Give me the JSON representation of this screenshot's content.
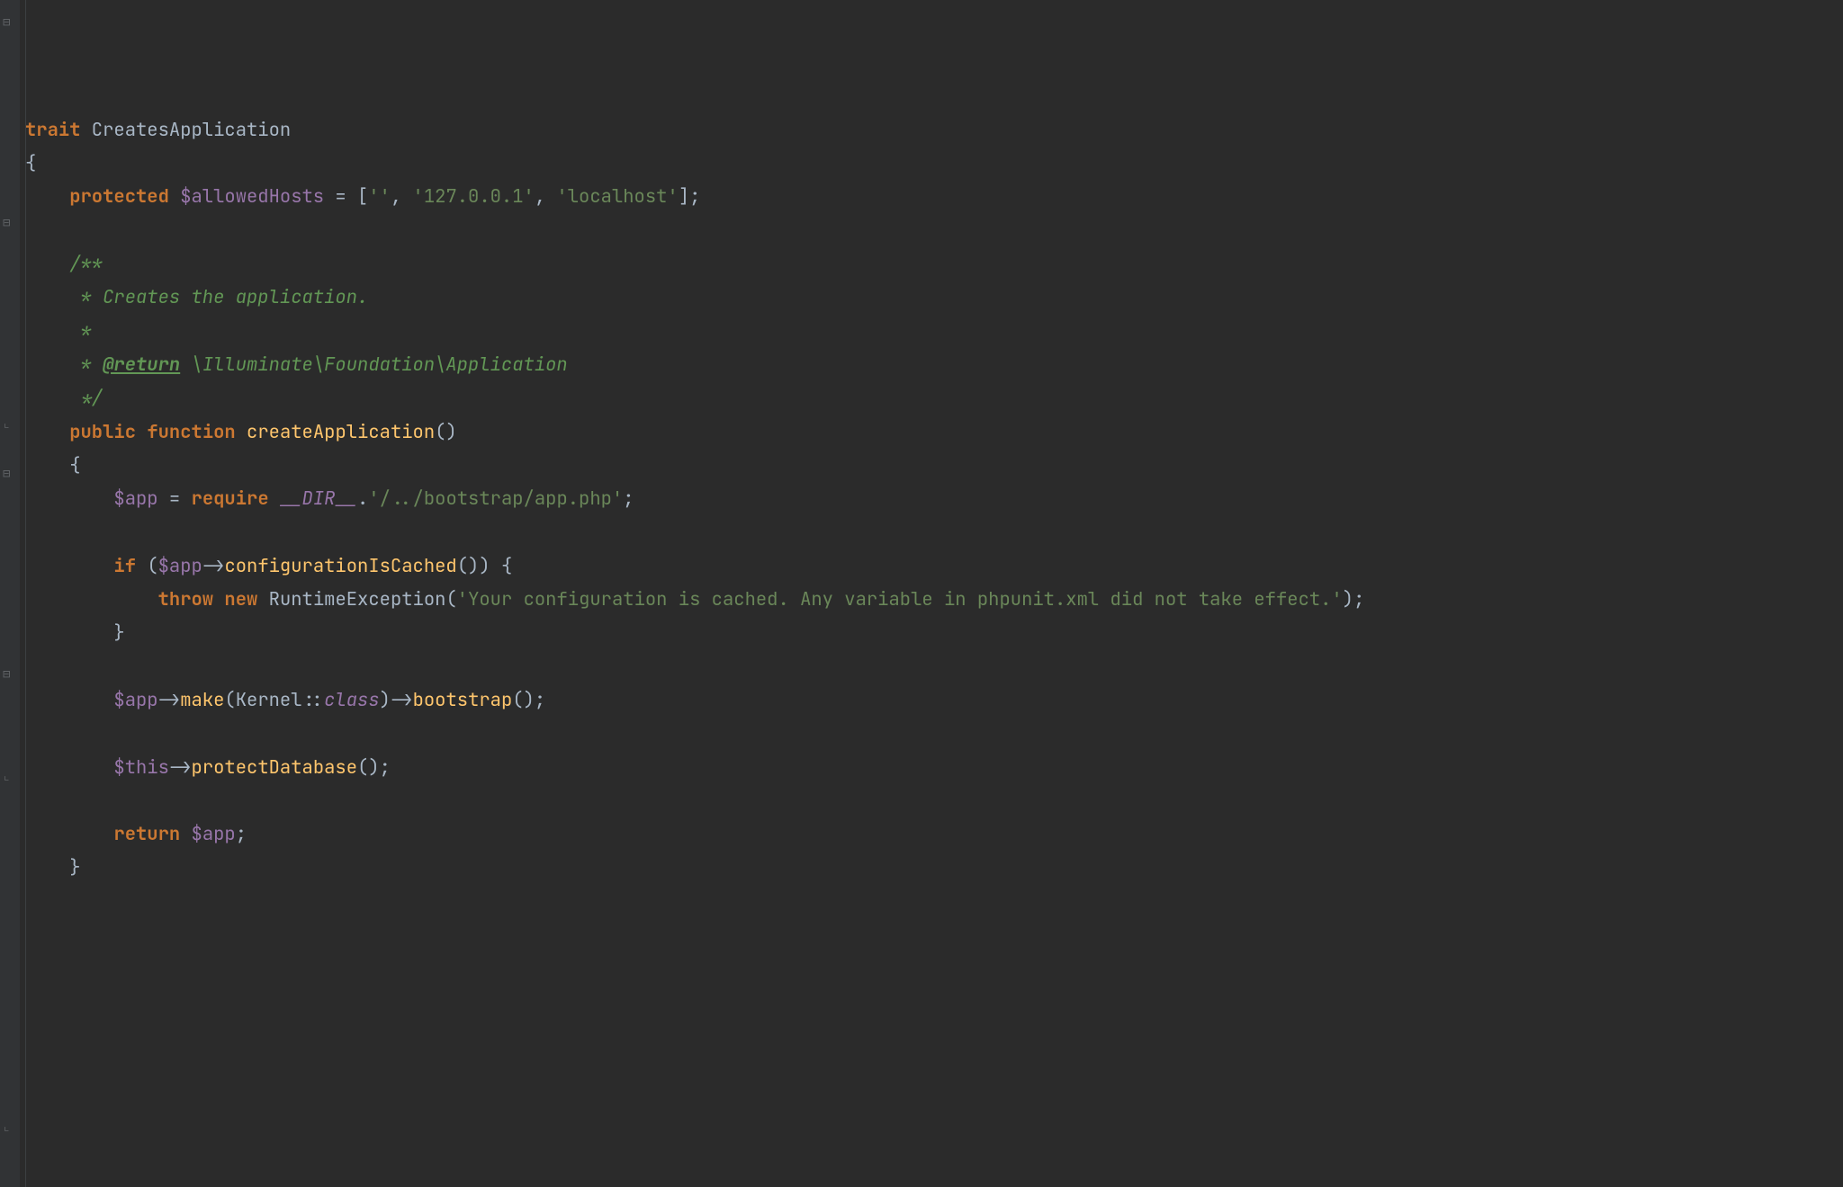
{
  "code": {
    "trait_kw": "trait",
    "trait_name": " CreatesApplication",
    "lbrace": "{",
    "rbrace": "}",
    "protected_kw": "protected",
    "allowedHosts_var": " $allowedHosts",
    "eq_open": " = [",
    "hosts_str1": "''",
    "comma_sep": ", ",
    "hosts_str2": "'127.0.0.1'",
    "hosts_str3": "'localhost'",
    "close_arr_semi": "];",
    "doc_open": "/**",
    "doc_star": " *",
    "doc_line1": " * Creates the application.",
    "doc_return_tag": "@return",
    "doc_return_type": " \\Illuminate\\Foundation\\Application",
    "doc_close": " */",
    "public_kw": "public",
    "function_kw": "function",
    "fn_name": "createApplication",
    "fn_parens": "()",
    "app_var": "$app",
    "eq": " = ",
    "require_kw": "require ",
    "dir_magic": "__DIR__",
    "dot": ".",
    "bootstrap_path": "'/../bootstrap/app.php'",
    "semi": ";",
    "if_kw": "if",
    "sp_open_paren": " (",
    "arrow": "->",
    "configurationIsCached": "configurationIsCached",
    "call_close_brace": "()) {",
    "throw_kw": "throw",
    "new_kw": "new",
    "RuntimeException": "RuntimeException",
    "open_paren": "(",
    "exc_msg": "'Your configuration is cached. Any variable in phpunit.xml did not take effect.'",
    "close_paren_semi": ");",
    "close_brace": "}",
    "make": "make",
    "Kernel": "Kernel",
    "dbl_colon": "::",
    "class_kw": "class",
    "close_paren": ")",
    "bootstrap": "bootstrap",
    "empty_call_semi": "();",
    "this_var": "$this",
    "protectDatabase": "protectDatabase",
    "return_kw": "return",
    "sp": " ",
    "indent1": "    ",
    "indent2": "        ",
    "indent3": "            ",
    "doc_star_sp": " * "
  }
}
